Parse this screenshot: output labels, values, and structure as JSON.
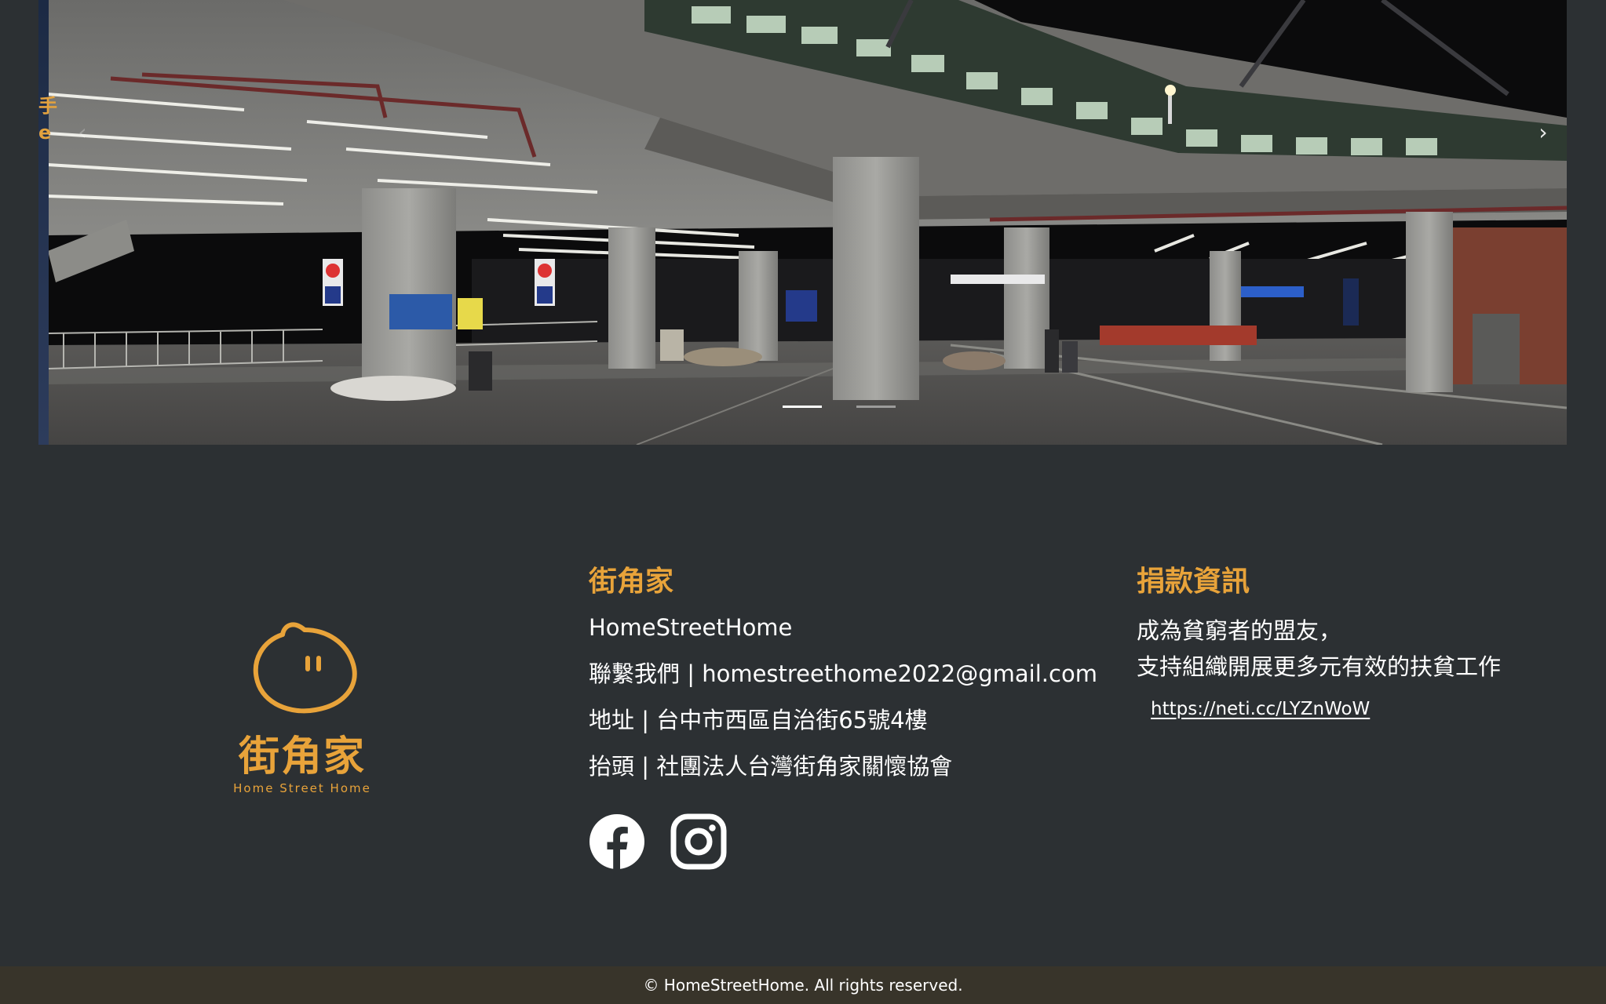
{
  "carousel": {
    "peek_text": "手\ne",
    "prev_icon": "‹",
    "next_icon": "›",
    "slide_count": 2,
    "active_slide": 1
  },
  "brand": {
    "logo_cn": "街角家",
    "logo_en": "Home Street Home",
    "accent_color": "#e8a33a"
  },
  "contact": {
    "title": "街角家",
    "name": "HomeStreetHome",
    "email_line": "聯繫我們 | homestreethome2022@gmail.com",
    "address_line": "地址 | 台中市西區自治街65號4樓",
    "org_line": "抬頭 | 社團法人台灣街角家關懷協會",
    "social": [
      "facebook-icon",
      "instagram-icon"
    ]
  },
  "donate": {
    "title": "捐款資訊",
    "line1": "成為貧窮者的盟友，",
    "line2": "支持組織開展更多元有效的扶貧工作",
    "link": "https://neti.cc/LYZnWoW"
  },
  "footer": {
    "copyright": "© HomeStreetHome. All rights reserved."
  }
}
